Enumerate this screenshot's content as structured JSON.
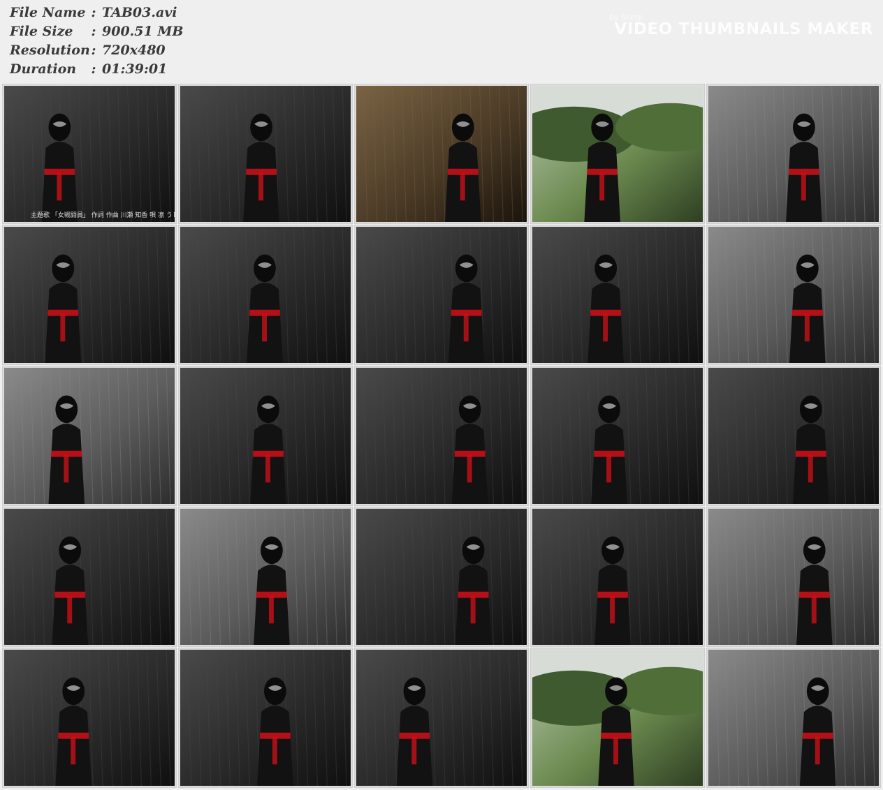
{
  "file_info": {
    "rows": [
      {
        "label": "File Name",
        "sep": ":",
        "value": "TAB03.avi"
      },
      {
        "label": "File Size",
        "sep": ":",
        "value": "900.51 MB"
      },
      {
        "label": "Resolution",
        "sep": ":",
        "value": "720x480"
      },
      {
        "label": "Duration",
        "sep": ":",
        "value": "01:39:01"
      }
    ]
  },
  "watermark": {
    "by": "by Scorp",
    "title": "VIDEO THUMBNAILS MAKER"
  },
  "thumbnails": [
    {
      "scene": "dark",
      "caption": "主題歌 「女戦闘員」 作詞 作曲 川瀬 知香 唄 凛 うし子"
    },
    {
      "scene": "dark"
    },
    {
      "scene": "brown"
    },
    {
      "scene": "outdoor"
    },
    {
      "scene": "grey"
    },
    {
      "scene": "dark"
    },
    {
      "scene": "dark"
    },
    {
      "scene": "dark"
    },
    {
      "scene": "dark"
    },
    {
      "scene": "grey"
    },
    {
      "scene": "grey"
    },
    {
      "scene": "dark"
    },
    {
      "scene": "dark"
    },
    {
      "scene": "dark"
    },
    {
      "scene": "dark"
    },
    {
      "scene": "dark"
    },
    {
      "scene": "grey"
    },
    {
      "scene": "dark"
    },
    {
      "scene": "dark"
    },
    {
      "scene": "grey"
    },
    {
      "scene": "dark"
    },
    {
      "scene": "dark"
    },
    {
      "scene": "dark"
    },
    {
      "scene": "outdoor"
    },
    {
      "scene": "grey"
    }
  ],
  "colors": {
    "background": "#efefef",
    "label_text": "#3a3a3a",
    "accent_red": "#c81018",
    "dark": "#1c1c1c",
    "outdoor_green": "#4d6b3a"
  }
}
